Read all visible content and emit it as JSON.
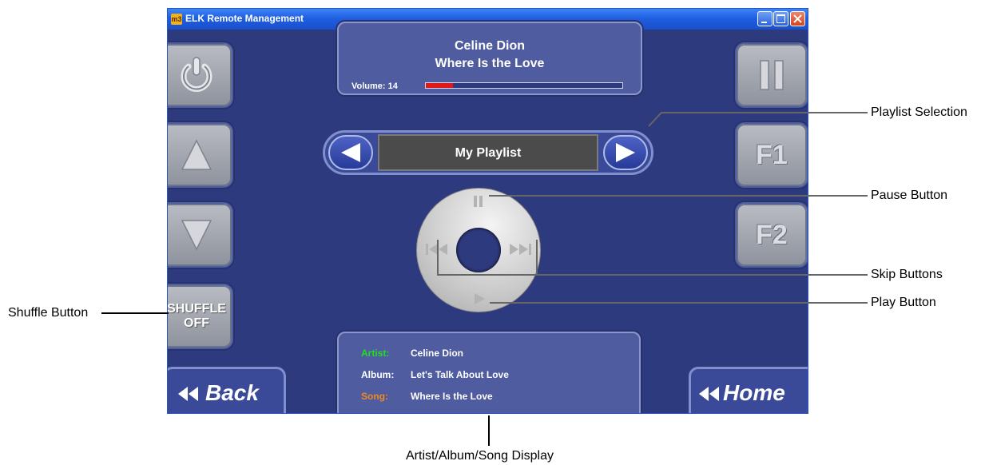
{
  "window": {
    "title": "ELK Remote Management",
    "app_icon": "m3"
  },
  "now_playing": {
    "artist": "Celine Dion",
    "song": "Where Is the Love",
    "volume_label": "Volume: 14",
    "volume_fraction": 0.14
  },
  "playlist": {
    "name": "My Playlist"
  },
  "side_buttons": {
    "shuffle_line1": "SHUFFLE",
    "shuffle_line2": "OFF",
    "f1": "F1",
    "f2": "F2",
    "back": "Back",
    "home": "Home"
  },
  "info": {
    "artist_key": "Artist:",
    "artist_value": "Celine Dion",
    "album_key": "Album:",
    "album_value": "Let's Talk About Love",
    "song_key": "Song:",
    "song_value": "Where Is the Love"
  },
  "colors": {
    "artist_key": "#22dd22",
    "album_key": "#ffffff",
    "song_key": "#ee8822",
    "volume": "#e01818"
  },
  "callouts": {
    "playlist_selection": "Playlist Selection",
    "pause_button": "Pause Button",
    "skip_buttons": "Skip Buttons",
    "play_button": "Play Button",
    "shuffle_button": "Shuffle Button",
    "display": "Artist/Album/Song Display"
  }
}
